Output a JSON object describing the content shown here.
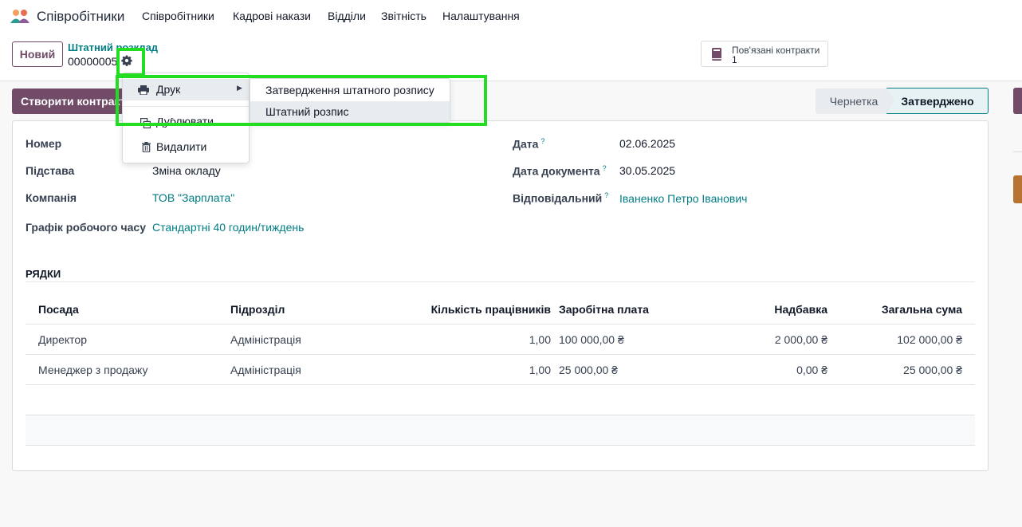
{
  "navbar": {
    "app_name": "Співробітники",
    "menu": [
      "Співробітники",
      "Кадрові накази",
      "Відділи",
      "Звітність",
      "Налаштування"
    ]
  },
  "control_panel": {
    "new_button": "Новий",
    "breadcrumb_parent": "Штатний розклад",
    "record_name": "00000005",
    "smart_button": {
      "label": "Пов'язані контракти",
      "count": "1"
    }
  },
  "header": {
    "create_button": "Створити контракт",
    "status": {
      "draft": "Чернетка",
      "approved": "Затверджено",
      "current": "Затверджено"
    }
  },
  "form": {
    "left": [
      {
        "label": "Номер",
        "value": ""
      },
      {
        "label": "Підстава",
        "value": "Зміна окладу"
      },
      {
        "label": "Компанія",
        "value": "ТОВ \"Зарплата\""
      },
      {
        "label": "Графік робочого часу",
        "value": "Стандартні 40 годин/тиждень"
      }
    ],
    "right": [
      {
        "label": "Дата",
        "help": "?",
        "value": "02.06.2025"
      },
      {
        "label": "Дата документа",
        "help": "?",
        "value": "30.05.2025"
      },
      {
        "label": "Відповідальний",
        "help": "?",
        "value": "Іваненко Петро Іванович"
      }
    ]
  },
  "lines": {
    "section_title": "РЯДКИ",
    "columns": [
      "Посада",
      "Підрозділ",
      "Кількість працівників",
      "Заробітна плата",
      "Надбавка",
      "Загальна сума"
    ],
    "rows": [
      [
        "Директор",
        "Адміністрація",
        "1,00",
        "100 000,00 ₴",
        "2 000,00 ₴",
        "102 000,00 ₴"
      ],
      [
        "Менеджер з продажу",
        "Адміністрація",
        "1,00",
        "25 000,00 ₴",
        "0,00 ₴",
        "25 000,00 ₴"
      ]
    ]
  },
  "action_menu": {
    "print": "Друк",
    "duplicate": "Дублювати",
    "delete": "Видалити",
    "print_submenu": [
      "Затвердження штатного розпису",
      "Штатний розпис"
    ]
  },
  "colors": {
    "brand": "#714b67",
    "link": "#017e84",
    "highlight": "#22dd22"
  }
}
